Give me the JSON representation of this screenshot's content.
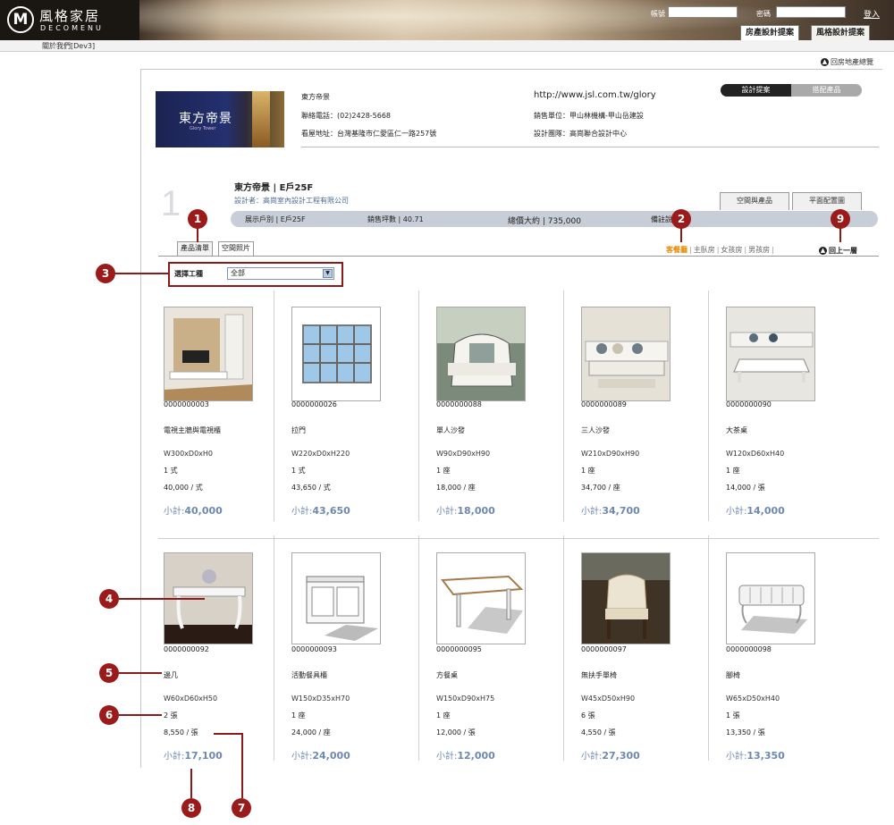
{
  "header": {
    "logo_mark": "M",
    "logo_cn": "風格家居",
    "logo_en": "DECOMENU",
    "account_label": "帳號",
    "password_label": "密碼",
    "login_link": "登入",
    "tabs": [
      "房產設計提案",
      "風格設計提案"
    ]
  },
  "subbar": {
    "text": "關於我們[Dev3]"
  },
  "back_top": "回房地產總覽",
  "project": {
    "logo_text": "東方帝景",
    "logo_sub": "Glory Tower",
    "name": "東方帝景",
    "phone": "聯絡電話：(02)2428-5668",
    "address": "看屋地址：台灣基隆市仁愛區仁一路257號",
    "url": "http://www.jsl.com.tw/glory",
    "sales": "銷售單位：甲山林機構-甲山岳建設",
    "design_team": "設計團隊：高崗聯合設計中心",
    "segments": [
      "設計提案",
      "搭配產品"
    ]
  },
  "unit": {
    "number": "1",
    "title": "東方帝景 | E戶25F",
    "designer": "設計者：高崗室內設計工程有限公司",
    "view_tabs": [
      "空間與產品",
      "平面配置圖"
    ],
    "bar": {
      "type": "展示戶別 | E戶25F",
      "area": "銷售坪數 | 40.71",
      "total": "總價大約 | 735,000",
      "note": "備註說"
    }
  },
  "subtabs": [
    "產品清單",
    "空間照片"
  ],
  "rooms": [
    "客餐廳",
    "主臥房",
    "女孩房",
    "男孩房"
  ],
  "back_button": "回上一層",
  "filter": {
    "label": "選擇工種",
    "value": "全部"
  },
  "subtotal_label": "小計:",
  "products": [
    {
      "code": "0000000003",
      "name": "電視主牆與電視櫃",
      "dim": "W300xD0xH0",
      "qty": "1 式",
      "price": "40,000 / 式",
      "subtotal": "40,000",
      "img": "tv-wall"
    },
    {
      "code": "0000000026",
      "name": "拉門",
      "dim": "W220xD0xH220",
      "qty": "1 式",
      "price": "43,650 / 式",
      "subtotal": "43,650",
      "img": "sliding-door"
    },
    {
      "code": "0000000088",
      "name": "單人沙發",
      "dim": "W90xD90xH90",
      "qty": "1 座",
      "price": "18,000 / 座",
      "subtotal": "18,000",
      "img": "armchair"
    },
    {
      "code": "0000000089",
      "name": "三人沙發",
      "dim": "W210xD90xH90",
      "qty": "1 座",
      "price": "34,700 / 座",
      "subtotal": "34,700",
      "img": "sofa"
    },
    {
      "code": "0000000090",
      "name": "大茶桌",
      "dim": "W120xD60xH40",
      "qty": "1 座",
      "price": "14,000 / 張",
      "subtotal": "14,000",
      "img": "coffee-table"
    },
    {
      "code": "0000000092",
      "name": "邊几",
      "dim": "W60xD60xH50",
      "qty": "2 張",
      "price": "8,550 / 張",
      "subtotal": "17,100",
      "img": "side-table"
    },
    {
      "code": "0000000093",
      "name": "活動餐具櫃",
      "dim": "W150xD35xH70",
      "qty": "1 座",
      "price": "24,000 / 座",
      "subtotal": "24,000",
      "img": "sideboard"
    },
    {
      "code": "0000000095",
      "name": "方餐桌",
      "dim": "W150xD90xH75",
      "qty": "1 座",
      "price": "12,000 / 張",
      "subtotal": "12,000",
      "img": "dining-table"
    },
    {
      "code": "0000000097",
      "name": "無扶手單椅",
      "dim": "W45xD50xH90",
      "qty": "6 張",
      "price": "4,550 / 張",
      "subtotal": "27,300",
      "img": "chair"
    },
    {
      "code": "0000000098",
      "name": "腳椅",
      "dim": "W65xD50xH40",
      "qty": "1 張",
      "price": "13,350 / 張",
      "subtotal": "13,350",
      "img": "ottoman"
    }
  ],
  "markers": [
    "1",
    "2",
    "3",
    "4",
    "5",
    "6",
    "7",
    "8",
    "9"
  ],
  "colors": {
    "marker": "#9b1b1b",
    "subtotal": "#6d88b2",
    "active_room": "#e68a00"
  }
}
